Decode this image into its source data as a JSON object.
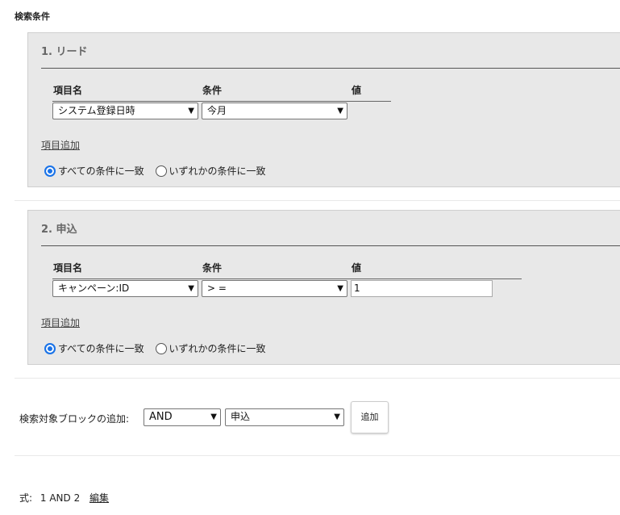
{
  "heading": "検索条件",
  "blocks": [
    {
      "title": "1. リード",
      "col_field": "項目名",
      "col_cond": "条件",
      "col_value": "値",
      "field": "システム登録日時",
      "condition": "今月",
      "value": "",
      "add_item": "項目追加",
      "match_all": "すべての条件に一致",
      "match_any": "いずれかの条件に一致",
      "selected_match": "all"
    },
    {
      "title": "2. 申込",
      "col_field": "項目名",
      "col_cond": "条件",
      "col_value": "値",
      "field": "キャンペーン:ID",
      "condition": "> =",
      "value": "1",
      "add_item": "項目追加",
      "match_all": "すべての条件に一致",
      "match_any": "いずれかの条件に一致",
      "selected_match": "all"
    }
  ],
  "add_block": {
    "label": "検索対象ブロックの追加:",
    "operator": "AND",
    "target": "申込",
    "button": "追加"
  },
  "formula": {
    "label": "式:",
    "expression": "1 AND 2",
    "edit": "編集"
  },
  "colors": {
    "radio_selected": "#1a73e8",
    "block_bg": "#e8e8e8"
  }
}
